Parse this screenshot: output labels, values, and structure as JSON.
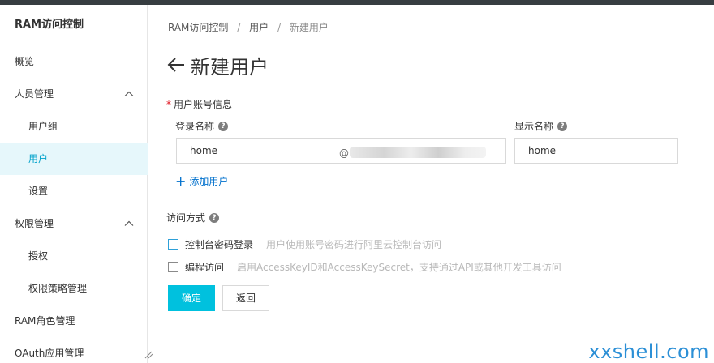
{
  "sidebar": {
    "title": "RAM访问控制",
    "items": [
      {
        "label": "概览"
      },
      {
        "label": "人员管理"
      },
      {
        "label": "用户组"
      },
      {
        "label": "用户"
      },
      {
        "label": "设置"
      },
      {
        "label": "权限管理"
      },
      {
        "label": "授权"
      },
      {
        "label": "权限策略管理"
      },
      {
        "label": "RAM角色管理"
      },
      {
        "label": "OAuth应用管理"
      }
    ]
  },
  "breadcrumb": [
    "RAM访问控制",
    "用户",
    "新建用户"
  ],
  "breadcrumb_separator": "/",
  "page": {
    "title": "新建用户"
  },
  "form": {
    "section_label": "用户账号信息",
    "required_mark": "*",
    "login_name": {
      "label": "登录名称",
      "value": "home",
      "at": "@"
    },
    "display_name": {
      "label": "显示名称",
      "value": "home"
    },
    "add_user_label": "添加用户",
    "access_label": "访问方式",
    "options": [
      {
        "label": "控制台密码登录",
        "hint": "用户使用账号密码进行阿里云控制台访问",
        "checked": false
      },
      {
        "label": "编程访问",
        "hint": "启用AccessKeyID和AccessKeySecret，支持通过API或其他开发工具访问",
        "checked": false
      }
    ],
    "confirm_label": "确定",
    "back_label": "返回"
  },
  "watermark": "xxshell.com",
  "colors": {
    "accent": "#00c1de",
    "link": "#0070cc",
    "active_bg": "#e6f7fb",
    "active_text": "#00a2ca",
    "required": "#e0101c",
    "watermark": "#2b8fd6"
  }
}
